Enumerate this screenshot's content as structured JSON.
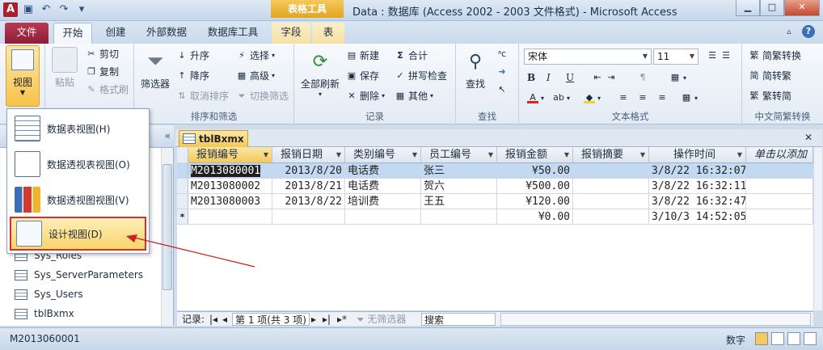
{
  "window": {
    "title": "Data : 数据库 (Access 2002 - 2003 文件格式) - Microsoft Access",
    "context_tab_header": "表格工具",
    "app_icon": "A"
  },
  "tabs": [
    "文件",
    "开始",
    "创建",
    "外部数据",
    "数据库工具",
    "字段",
    "表"
  ],
  "ribbon": {
    "view_label": "视图",
    "paste_label": "粘贴",
    "cut_label": "剪切",
    "copy_label": "复制",
    "format_painter_label": "格式刷",
    "filter_label": "筛选器",
    "ascending_label": "升序",
    "descending_label": "降序",
    "remove_sort_label": "取消排序",
    "selection_label": "选择",
    "advanced_label": "高级",
    "toggle_filter_label": "切换筛选",
    "sort_filter_group": "排序和筛选",
    "refresh_all_label": "全部刷新",
    "new_label": "新建",
    "save_label": "保存",
    "delete_label": "删除",
    "totals_label": "合计",
    "spelling_label": "拼写检查",
    "other_label": "其他",
    "records_group": "记录",
    "find_label": "查找",
    "find_group": "查找",
    "font_name": "宋体",
    "font_size": "11",
    "text_format_group": "文本格式",
    "to_traditional_label": "简繁转换",
    "to_simplified_label": "繁转简",
    "chs_cht_label": "简转繁",
    "chinese_conv_group": "中文简繁转换"
  },
  "view_menu": {
    "items": [
      {
        "label": "数据表视图(H)"
      },
      {
        "label": "数据透视表视图(O)"
      },
      {
        "label": "数据透视图视图(V)"
      },
      {
        "label": "设计视图(D)"
      }
    ]
  },
  "nav": {
    "items": [
      "Sys_Roles",
      "Sys_ServerParameters",
      "Sys_Users",
      "tblBxmx"
    ]
  },
  "document": {
    "tab_label": "tblBxmx",
    "columns": [
      "报销编号",
      "报销日期",
      "类别编号",
      "员工编号",
      "报销金额",
      "报销摘要",
      "操作时间",
      "单击以添加"
    ],
    "rows": [
      [
        "M2013080001",
        "2013/8/20",
        "电话费",
        "张三",
        "¥50.00",
        "",
        "3/8/22 16:32:07"
      ],
      [
        "M2013080002",
        "2013/8/21",
        "电话费",
        "贺六",
        "¥500.00",
        "",
        "3/8/22 16:32:11"
      ],
      [
        "M2013080003",
        "2013/8/22",
        "培训费",
        "王五",
        "¥120.00",
        "",
        "3/8/22 16:32:47"
      ]
    ],
    "new_row": [
      "",
      "",
      "",
      "",
      "¥0.00",
      "",
      "3/10/3 14:52:05"
    ],
    "new_row_marker": "*"
  },
  "recnav": {
    "label": "记录:",
    "position": "第 1 项(共 3 项)",
    "no_filter": "无筛选器",
    "search": "搜索"
  },
  "status": {
    "left": "M2013060001",
    "right": "数字"
  }
}
